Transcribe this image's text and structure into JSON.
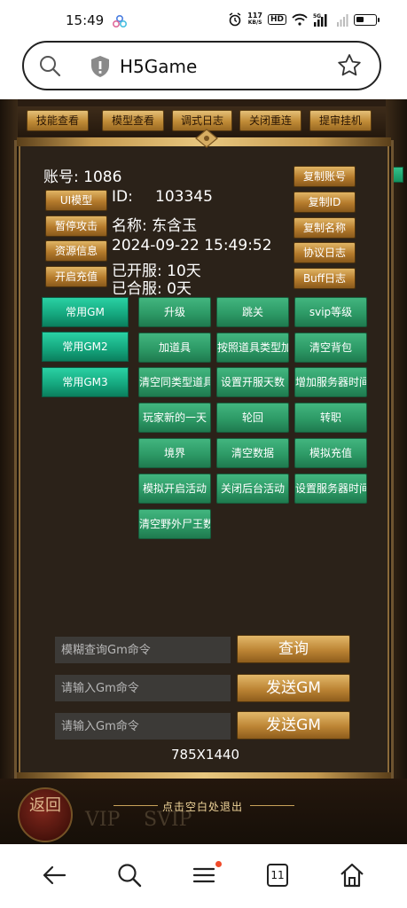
{
  "status_bar": {
    "time": "15:49",
    "net_speed_value": "117",
    "net_speed_unit": "KB/S",
    "hd_label": "HD",
    "signal_label": "5G"
  },
  "browser": {
    "page_title": "H5Game",
    "open_tabs": "11"
  },
  "game": {
    "top_buttons": [
      "技能查看",
      "模型查看",
      "调式日志",
      "关闭重连",
      "提审挂机"
    ],
    "account": {
      "account_line": "账号: 1086",
      "id_label": "ID:",
      "id_value": "103345",
      "name_line": "名称: 东含玉",
      "datetime": "2024-09-22 15:49:52",
      "open_days": "已开服: 10天",
      "merge_days": "已合服: 0天"
    },
    "left_buttons": [
      "UI模型",
      "暂停攻击",
      "资源信息",
      "开启充值"
    ],
    "right_buttons": [
      "复制账号",
      "复制ID",
      "复制名称",
      "协议日志",
      "Buff日志"
    ],
    "gm_flag": "GM",
    "gm_tabs": [
      "常用GM",
      "常用GM2",
      "常用GM3"
    ],
    "gm_commands": [
      "升级",
      "跳关",
      "svip等级",
      "加道具",
      "按照道具类型加",
      "清空背包",
      "清空同类型道具",
      "设置开服天数",
      "增加服务器时间",
      "玩家新的一天",
      "轮回",
      "转职",
      "境界",
      "清空数据",
      "模拟充值",
      "模拟开启活动",
      "关闭后台活动",
      "设置服务器时间",
      "清空野外尸王数"
    ],
    "search_placeholder": "模糊查询Gm命令",
    "query_button": "查询",
    "input_placeholder_1": "请输入Gm命令",
    "send_button_1": "发送GM",
    "input_placeholder_2": "请输入Gm命令",
    "send_button_2": "发送GM",
    "resolution": "785X1440",
    "exit_hint": "点击空白处退出",
    "return_label": "返回",
    "vip_label_1": "VIP",
    "vip_label_2": "SVIP"
  },
  "colors": {
    "gold_button": "#c08b36",
    "green_button": "#2d9a66",
    "teal_tab": "#14a57c",
    "panel_bg": "#2b2219"
  }
}
